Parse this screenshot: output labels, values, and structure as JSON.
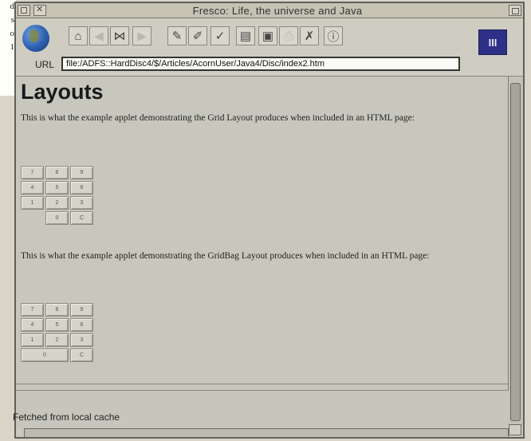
{
  "margin_fragment": [
    "d",
    "s",
    "o",
    "1"
  ],
  "window": {
    "title": "Fresco: Life, the universe and Java"
  },
  "toolbar": {
    "buttons": [
      {
        "name": "home-icon",
        "glyph": "⌂",
        "enabled": true
      },
      {
        "name": "back-arrow-icon",
        "glyph": "◀",
        "enabled": false
      },
      {
        "name": "stop-icon",
        "glyph": "⋈",
        "enabled": true
      },
      {
        "name": "forward-arrow-icon",
        "glyph": "▶",
        "enabled": false
      },
      {
        "name": "edit-icon",
        "glyph": "✎",
        "enabled": true
      },
      {
        "name": "pen-icon",
        "glyph": "✐",
        "enabled": true
      },
      {
        "name": "mark-icon",
        "glyph": "✓",
        "enabled": true
      },
      {
        "name": "document-icon",
        "glyph": "▤",
        "enabled": true
      },
      {
        "name": "save-icon",
        "glyph": "▣",
        "enabled": true
      },
      {
        "name": "print-icon",
        "glyph": "⎙",
        "enabled": false
      },
      {
        "name": "tools-icon",
        "glyph": "✗",
        "enabled": true
      },
      {
        "name": "info-icon",
        "glyph": "ⓘ",
        "enabled": true
      }
    ],
    "logo_text": "III",
    "url_label": "URL",
    "url_value": "file:/ADFS::HardDisc4/$/Articles/AcornUser/Java4/Disc/index2.htm"
  },
  "content": {
    "heading": "Layouts",
    "para1": "This is what the example applet demonstrating the Grid Layout produces when included in an HTML page:",
    "para2": "This is what the example applet demonstrating the GridBag Layout produces when included in an HTML page:",
    "grid_keys": [
      "7",
      "8",
      "9",
      "4",
      "5",
      "6",
      "1",
      "2",
      "3",
      "0",
      "C"
    ],
    "gridbag_keys": [
      "7",
      "8",
      "9",
      "4",
      "5",
      "6",
      "1",
      "2",
      "3",
      "0",
      "C"
    ]
  },
  "status": {
    "text": "Fetched from local cache"
  }
}
